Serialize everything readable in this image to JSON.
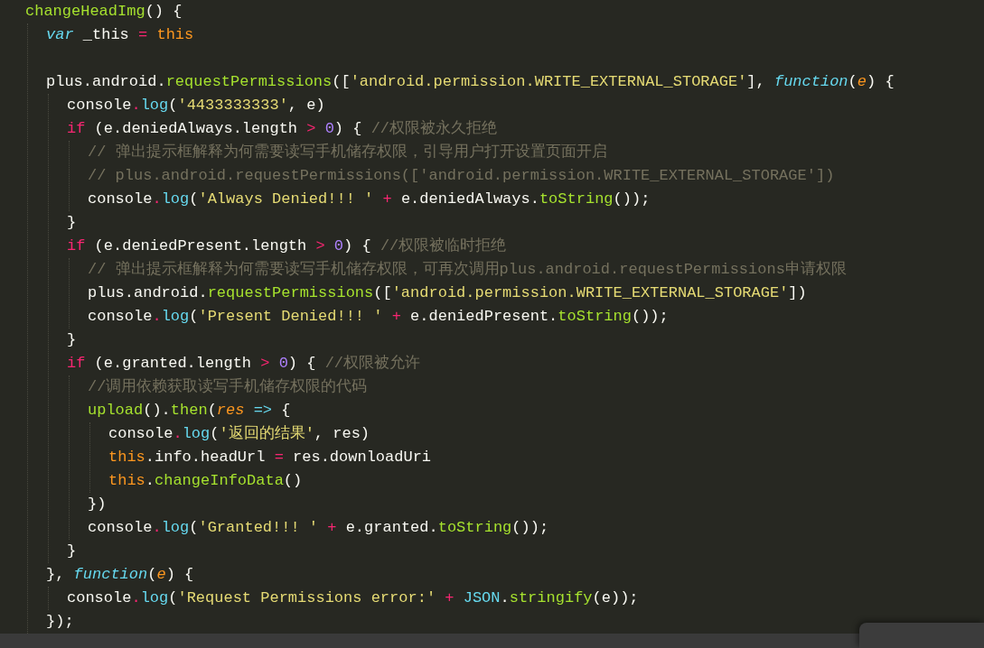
{
  "editor": {
    "lines": [
      {
        "kind": "code",
        "tokens": [
          {
            "kind": "fn",
            "text": "changeHeadImg"
          },
          {
            "kind": "plain",
            "text": "() {"
          }
        ],
        "children": [
          {
            "kind": "code",
            "tokens": [
              {
                "kind": "storage",
                "text": "var"
              },
              {
                "kind": "plain",
                "text": " _this "
              },
              {
                "kind": "keyword",
                "text": "="
              },
              {
                "kind": "this",
                "text": " this"
              }
            ]
          },
          {
            "kind": "blank"
          },
          {
            "kind": "code",
            "tokens": [
              {
                "kind": "plain",
                "text": "plus.android."
              },
              {
                "kind": "fn",
                "text": "requestPermissions"
              },
              {
                "kind": "plain",
                "text": "(["
              },
              {
                "kind": "string",
                "text": "'android.permission.WRITE_EXTERNAL_STORAGE'"
              },
              {
                "kind": "plain",
                "text": "], "
              },
              {
                "kind": "storage",
                "text": "function"
              },
              {
                "kind": "plain",
                "text": "("
              },
              {
                "kind": "param",
                "text": "e"
              },
              {
                "kind": "plain",
                "text": ") {"
              }
            ],
            "children": [
              {
                "kind": "code",
                "tokens": [
                  {
                    "kind": "plain",
                    "text": "console"
                  },
                  {
                    "kind": "keyword",
                    "text": "."
                  },
                  {
                    "kind": "method",
                    "text": "log"
                  },
                  {
                    "kind": "plain",
                    "text": "("
                  },
                  {
                    "kind": "string",
                    "text": "'4433333333'"
                  },
                  {
                    "kind": "plain",
                    "text": ", e)"
                  }
                ]
              },
              {
                "kind": "code",
                "tokens": [
                  {
                    "kind": "keyword",
                    "text": "if"
                  },
                  {
                    "kind": "plain",
                    "text": " (e.deniedAlways.length "
                  },
                  {
                    "kind": "keyword",
                    "text": ">"
                  },
                  {
                    "kind": "number",
                    "text": " 0"
                  },
                  {
                    "kind": "plain",
                    "text": ") { "
                  },
                  {
                    "kind": "comment",
                    "text": "//权限被永久拒绝"
                  }
                ],
                "children": [
                  {
                    "kind": "code",
                    "tokens": [
                      {
                        "kind": "comment",
                        "text": "// 弹出提示框解释为何需要读写手机储存权限，引导用户打开设置页面开启"
                      }
                    ]
                  },
                  {
                    "kind": "code",
                    "tokens": [
                      {
                        "kind": "comment",
                        "text": "// plus.android.requestPermissions(['android.permission.WRITE_EXTERNAL_STORAGE'])"
                      }
                    ]
                  },
                  {
                    "kind": "code",
                    "tokens": [
                      {
                        "kind": "plain",
                        "text": "console"
                      },
                      {
                        "kind": "keyword",
                        "text": "."
                      },
                      {
                        "kind": "method",
                        "text": "log"
                      },
                      {
                        "kind": "plain",
                        "text": "("
                      },
                      {
                        "kind": "string",
                        "text": "'Always Denied!!! '"
                      },
                      {
                        "kind": "keyword",
                        "text": " +"
                      },
                      {
                        "kind": "plain",
                        "text": " e.deniedAlways."
                      },
                      {
                        "kind": "fn",
                        "text": "toString"
                      },
                      {
                        "kind": "plain",
                        "text": "());"
                      }
                    ]
                  }
                ]
              },
              {
                "kind": "code",
                "tokens": [
                  {
                    "kind": "plain",
                    "text": "}"
                  }
                ]
              },
              {
                "kind": "code",
                "tokens": [
                  {
                    "kind": "keyword",
                    "text": "if"
                  },
                  {
                    "kind": "plain",
                    "text": " (e.deniedPresent.length "
                  },
                  {
                    "kind": "keyword",
                    "text": ">"
                  },
                  {
                    "kind": "number",
                    "text": " 0"
                  },
                  {
                    "kind": "plain",
                    "text": ") { "
                  },
                  {
                    "kind": "comment",
                    "text": "//权限被临时拒绝"
                  }
                ],
                "children": [
                  {
                    "kind": "code",
                    "tokens": [
                      {
                        "kind": "comment",
                        "text": "// 弹出提示框解释为何需要读写手机储存权限，可再次调用plus.android.requestPermissions申请权限"
                      }
                    ]
                  },
                  {
                    "kind": "code",
                    "tokens": [
                      {
                        "kind": "plain",
                        "text": "plus.android."
                      },
                      {
                        "kind": "fn",
                        "text": "requestPermissions"
                      },
                      {
                        "kind": "plain",
                        "text": "(["
                      },
                      {
                        "kind": "string",
                        "text": "'android.permission.WRITE_EXTERNAL_STORAGE'"
                      },
                      {
                        "kind": "plain",
                        "text": "])"
                      }
                    ]
                  },
                  {
                    "kind": "code",
                    "tokens": [
                      {
                        "kind": "plain",
                        "text": "console"
                      },
                      {
                        "kind": "keyword",
                        "text": "."
                      },
                      {
                        "kind": "method",
                        "text": "log"
                      },
                      {
                        "kind": "plain",
                        "text": "("
                      },
                      {
                        "kind": "string",
                        "text": "'Present Denied!!! '"
                      },
                      {
                        "kind": "keyword",
                        "text": " +"
                      },
                      {
                        "kind": "plain",
                        "text": " e.deniedPresent."
                      },
                      {
                        "kind": "fn",
                        "text": "toString"
                      },
                      {
                        "kind": "plain",
                        "text": "());"
                      }
                    ]
                  }
                ]
              },
              {
                "kind": "code",
                "tokens": [
                  {
                    "kind": "plain",
                    "text": "}"
                  }
                ]
              },
              {
                "kind": "code",
                "tokens": [
                  {
                    "kind": "keyword",
                    "text": "if"
                  },
                  {
                    "kind": "plain",
                    "text": " (e.granted.length "
                  },
                  {
                    "kind": "keyword",
                    "text": ">"
                  },
                  {
                    "kind": "number",
                    "text": " 0"
                  },
                  {
                    "kind": "plain",
                    "text": ") { "
                  },
                  {
                    "kind": "comment",
                    "text": "//权限被允许"
                  }
                ],
                "children": [
                  {
                    "kind": "code",
                    "tokens": [
                      {
                        "kind": "comment",
                        "text": "//调用依赖获取读写手机储存权限的代码"
                      }
                    ]
                  },
                  {
                    "kind": "code",
                    "tokens": [
                      {
                        "kind": "fn",
                        "text": "upload"
                      },
                      {
                        "kind": "plain",
                        "text": "()."
                      },
                      {
                        "kind": "fn",
                        "text": "then"
                      },
                      {
                        "kind": "plain",
                        "text": "("
                      },
                      {
                        "kind": "param",
                        "text": "res"
                      },
                      {
                        "kind": "storage-plain",
                        "text": " =>"
                      },
                      {
                        "kind": "plain",
                        "text": " {"
                      }
                    ],
                    "children": [
                      {
                        "kind": "code",
                        "tokens": [
                          {
                            "kind": "plain",
                            "text": "console"
                          },
                          {
                            "kind": "keyword",
                            "text": "."
                          },
                          {
                            "kind": "method",
                            "text": "log"
                          },
                          {
                            "kind": "plain",
                            "text": "("
                          },
                          {
                            "kind": "string",
                            "text": "'返回的结果'"
                          },
                          {
                            "kind": "plain",
                            "text": ", res)"
                          }
                        ]
                      },
                      {
                        "kind": "code",
                        "tokens": [
                          {
                            "kind": "this",
                            "text": "this"
                          },
                          {
                            "kind": "plain",
                            "text": ".info.headUrl "
                          },
                          {
                            "kind": "keyword",
                            "text": "="
                          },
                          {
                            "kind": "plain",
                            "text": " res.downloadUri"
                          }
                        ]
                      },
                      {
                        "kind": "code",
                        "tokens": [
                          {
                            "kind": "this",
                            "text": "this"
                          },
                          {
                            "kind": "plain",
                            "text": "."
                          },
                          {
                            "kind": "fn",
                            "text": "changeInfoData"
                          },
                          {
                            "kind": "plain",
                            "text": "()"
                          }
                        ]
                      }
                    ]
                  },
                  {
                    "kind": "code",
                    "tokens": [
                      {
                        "kind": "plain",
                        "text": "})"
                      }
                    ]
                  },
                  {
                    "kind": "code",
                    "tokens": [
                      {
                        "kind": "plain",
                        "text": "console"
                      },
                      {
                        "kind": "keyword",
                        "text": "."
                      },
                      {
                        "kind": "method",
                        "text": "log"
                      },
                      {
                        "kind": "plain",
                        "text": "("
                      },
                      {
                        "kind": "string",
                        "text": "'Granted!!! '"
                      },
                      {
                        "kind": "keyword",
                        "text": " +"
                      },
                      {
                        "kind": "plain",
                        "text": " e.granted."
                      },
                      {
                        "kind": "fn",
                        "text": "toString"
                      },
                      {
                        "kind": "plain",
                        "text": "());"
                      }
                    ]
                  }
                ]
              },
              {
                "kind": "code",
                "tokens": [
                  {
                    "kind": "plain",
                    "text": "}"
                  }
                ]
              }
            ]
          },
          {
            "kind": "code",
            "tokens": [
              {
                "kind": "plain",
                "text": "}, "
              },
              {
                "kind": "storage",
                "text": "function"
              },
              {
                "kind": "plain",
                "text": "("
              },
              {
                "kind": "param",
                "text": "e"
              },
              {
                "kind": "plain",
                "text": ") {"
              }
            ],
            "children": [
              {
                "kind": "code",
                "tokens": [
                  {
                    "kind": "plain",
                    "text": "console"
                  },
                  {
                    "kind": "keyword",
                    "text": "."
                  },
                  {
                    "kind": "method",
                    "text": "log"
                  },
                  {
                    "kind": "plain",
                    "text": "("
                  },
                  {
                    "kind": "string",
                    "text": "'Request Permissions error:'"
                  },
                  {
                    "kind": "keyword",
                    "text": " +"
                  },
                  {
                    "kind": "storage-plain",
                    "text": " JSON"
                  },
                  {
                    "kind": "plain",
                    "text": "."
                  },
                  {
                    "kind": "fn",
                    "text": "stringify"
                  },
                  {
                    "kind": "plain",
                    "text": "(e));"
                  }
                ]
              }
            ]
          },
          {
            "kind": "code",
            "tokens": [
              {
                "kind": "plain",
                "text": "});"
              }
            ]
          }
        ]
      }
    ]
  }
}
